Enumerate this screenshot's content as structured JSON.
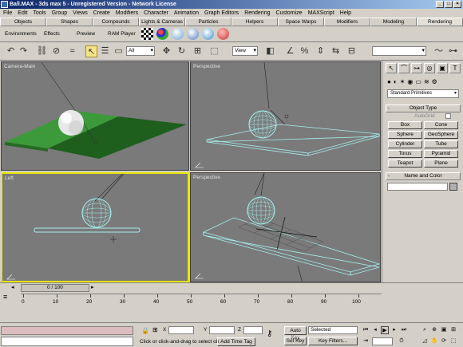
{
  "window": {
    "title": "Ball.MAX - 3ds max 5 - Unregistered Version - Network License",
    "min": "_",
    "max": "□",
    "close": "×"
  },
  "menu": [
    "File",
    "Edit",
    "Tools",
    "Group",
    "Views",
    "Create",
    "Modifiers",
    "Character",
    "Animation",
    "Graph Editors",
    "Rendering",
    "Customize",
    "MAXScript",
    "Help"
  ],
  "tabs": {
    "items": [
      "Objects",
      "Shapes",
      "Compounds",
      "Lights & Cameras",
      "Particles",
      "Helpers",
      "Space Warps",
      "Modifiers",
      "Modeling",
      "Rendering"
    ],
    "active": "Rendering"
  },
  "shelf": {
    "environments": "Environments",
    "effects": "Effects",
    "preview": "Preview",
    "ram_player": "RAM Player"
  },
  "toolbar": {
    "selection_filter": "All",
    "ref_coord": "View",
    "named_selection": ""
  },
  "viewports": [
    {
      "label": "Camera-Main"
    },
    {
      "label": "Perspective"
    },
    {
      "label": "Left"
    },
    {
      "label": "Perspective"
    }
  ],
  "command_panel": {
    "category": "Standard Primitives",
    "object_type": "Object Type",
    "autogrid": "AutoGrid",
    "buttons": [
      "Box",
      "Cone",
      "Sphere",
      "GeoSphere",
      "Cylinder",
      "Tube",
      "Torus",
      "Pyramid",
      "Teapot",
      "Plane"
    ],
    "name_color": "Name and Color"
  },
  "timeline": {
    "slider": "0 / 100",
    "ticks": [
      "0",
      "10",
      "20",
      "30",
      "40",
      "50",
      "60",
      "70",
      "80",
      "90",
      "100"
    ]
  },
  "status": {
    "prompt": "Click or click-and-drag to select ob",
    "add_time_tag": "Add Time Tag",
    "x_label": "X",
    "y_label": "Y",
    "z_label": "Z",
    "auto_key": "Auto Key",
    "set_key": "Set Key",
    "selected": "Selected",
    "key_filters": "Key Filters..."
  },
  "colors": {
    "active_viewport": "#e6e600",
    "ground_green": "#3d9a3a",
    "wire_cyan": "#a8f0f0",
    "titlebar": "#0a246a"
  }
}
